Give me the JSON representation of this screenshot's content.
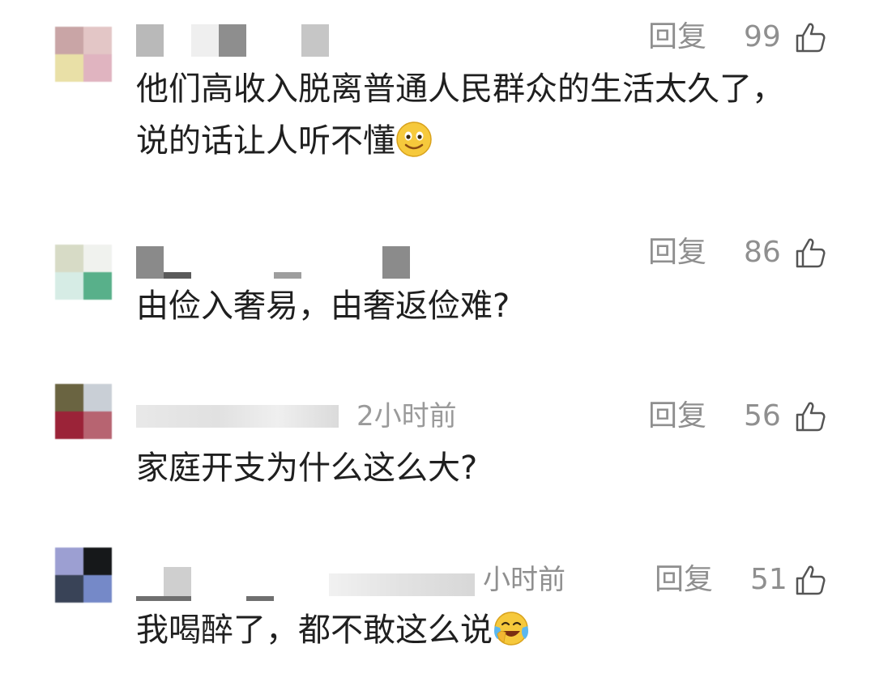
{
  "comments": [
    {
      "time": "",
      "reply_label": "回复",
      "likes": "99",
      "text": "他们高收入脱离普通人民群众的生活太久了，说的话让人听不懂",
      "emoji": "smiling-face",
      "avatar_colors": [
        "#c9a5a6",
        "#e3c6c6",
        "#e9e0a7",
        "#e0b4c0"
      ]
    },
    {
      "time": "",
      "reply_label": "回复",
      "likes": "86",
      "text": "由俭入奢易，由奢返俭难?",
      "avatar_colors": [
        "#d7dbc6",
        "#f0f2ee",
        "#d6ece5",
        "#58b08a"
      ]
    },
    {
      "time": "2小时前",
      "reply_label": "回复",
      "likes": "56",
      "text": "家庭开支为什么这么大?",
      "avatar_colors": [
        "#6a6441",
        "#c9cfd6",
        "#9b2338",
        "#b76471"
      ]
    },
    {
      "time": "小时前",
      "reply_label": "回复",
      "likes": "51",
      "text": "我喝醉了，都不敢这么说",
      "emoji": "face-with-tears-of-joy",
      "avatar_colors": [
        "#9c9fd2",
        "#16181a",
        "#394357",
        "#7589c8"
      ]
    }
  ]
}
